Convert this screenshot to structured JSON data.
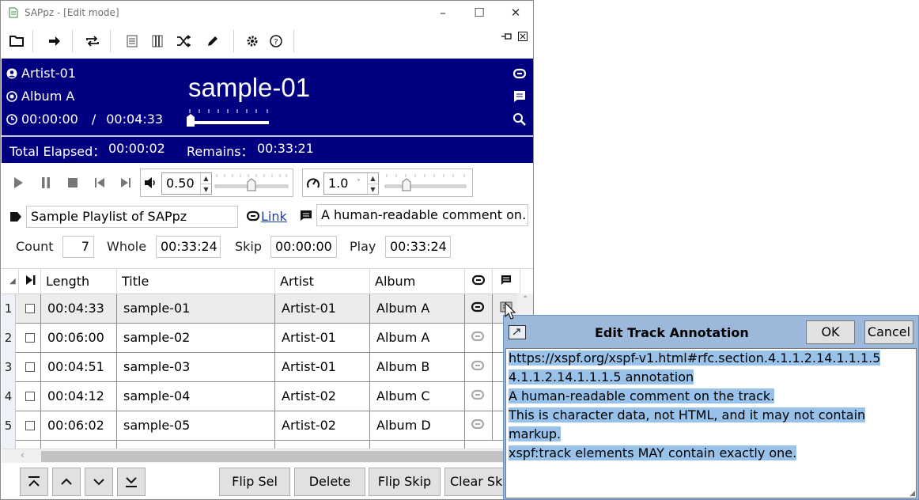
{
  "window": {
    "title": "SAPpz - [Edit mode]",
    "minimize": "–",
    "maximize": "☐",
    "close": "✕"
  },
  "now_playing": {
    "artist": "Artist-01",
    "album": "Album A",
    "time_current": "00:00:00",
    "time_separator": "/",
    "time_total": "00:04:33",
    "title": "sample-01",
    "position_fraction": 0.0,
    "total_elapsed_label": "Total Elapsed：",
    "total_elapsed": "00:00:02",
    "remains_label": "Remains：",
    "remains": "00:33:21"
  },
  "controls": {
    "volume": "0.50",
    "volume_fraction": 0.5,
    "speed": "1.0",
    "speed_fraction": 0.25
  },
  "playlist": {
    "title": "Sample Playlist of SAPpz",
    "link_label": "Link",
    "annotation": "A human-readable comment on…",
    "count_label": "Count",
    "count": "7",
    "whole_label": "Whole",
    "whole": "00:33:24",
    "skip_label": "Skip",
    "skip": "00:00:00",
    "play_label": "Play",
    "play": "00:33:24"
  },
  "table": {
    "headers": {
      "length": "Length",
      "title": "Title",
      "artist": "Artist",
      "album": "Album"
    },
    "rows": [
      {
        "n": "1",
        "length": "00:04:33",
        "title": "sample-01",
        "artist": "Artist-01",
        "album": "Album A"
      },
      {
        "n": "2",
        "length": "00:06:00",
        "title": "sample-02",
        "artist": "Artist-01",
        "album": "Album A"
      },
      {
        "n": "3",
        "length": "00:04:51",
        "title": "sample-03",
        "artist": "Artist-01",
        "album": "Album B"
      },
      {
        "n": "4",
        "length": "00:04:12",
        "title": "sample-04",
        "artist": "Artist-02",
        "album": "Album C"
      },
      {
        "n": "5",
        "length": "00:06:02",
        "title": "sample-05",
        "artist": "Artist-02",
        "album": "Album D"
      }
    ]
  },
  "bottom": {
    "flip_sel": "Flip Sel",
    "delete": "Delete",
    "flip_skip": "Flip Skip",
    "clear_skip": "Clear Skip"
  },
  "dialog": {
    "title": "Edit Track Annotation",
    "ok": "OK",
    "cancel": "Cancel",
    "lines": [
      "https://xspf.org/xspf-v1.html#rfc.section.4.1.1.2.14.1.1.1.5",
      "4.1.1.2.14.1.1.1.5 annotation",
      "A human-readable comment on the track.",
      "This is character data, not HTML, and it may not contain markup.",
      "xspf:track elements MAY contain exactly one."
    ]
  },
  "colors": {
    "hero_bg": "#000080",
    "selection": "#99c2ea",
    "dialog_frame": "#9cb8da"
  }
}
